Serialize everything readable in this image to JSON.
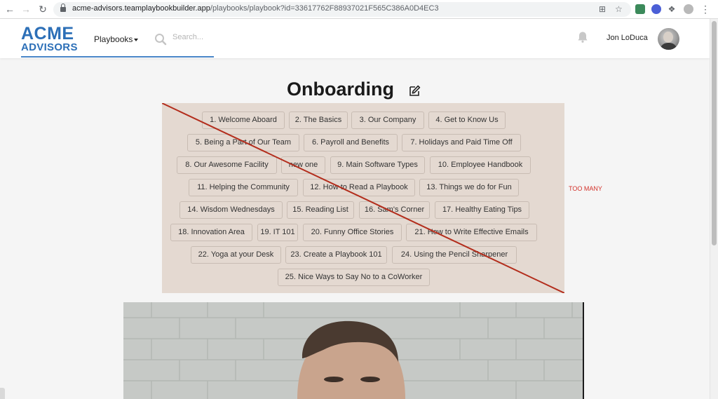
{
  "browser": {
    "url_host": "acme-advisors.teamplaybookbuilder.app",
    "url_path": "/playbooks/playbook?id=33617762F88937021F565C386A0D4EC3"
  },
  "header": {
    "logo_line1": "ACME",
    "logo_line2": "ADVISORS",
    "playbooks_label": "Playbooks",
    "search_placeholder": "Search...",
    "user_name": "Jon LoDuca",
    "accent_color": "#2c6fb7"
  },
  "page": {
    "title": "Onboarding",
    "annotation": "TOO MANY",
    "annotation_color": "#d3322b"
  },
  "chapters": [
    "1. Welcome Aboard",
    "2. The Basics",
    "3. Our Company",
    "4. Get to Know Us",
    "5. Being a Part of Our Team",
    "6. Payroll and Benefits",
    "7. Holidays and Paid Time Off",
    "8. Our Awesome Facility",
    "new one",
    "9. Main Software Types",
    "10. Employee Handbook",
    "11. Helping the Community",
    "12. How to Read a Playbook",
    "13. Things we do for Fun",
    "14. Wisdom Wednesdays",
    "15. Reading List",
    "16. Sam's Corner",
    "17. Healthy Eating Tips",
    "18. Innovation Area",
    "19. IT 101",
    "20. Funny Office Stories",
    "21. How to Write Effective Emails",
    "22. Yoga at your Desk",
    "23. Create a Playbook 101",
    "24. Using the Pencil Sharpener",
    "25. Nice Ways to Say No to a CoWorker"
  ]
}
